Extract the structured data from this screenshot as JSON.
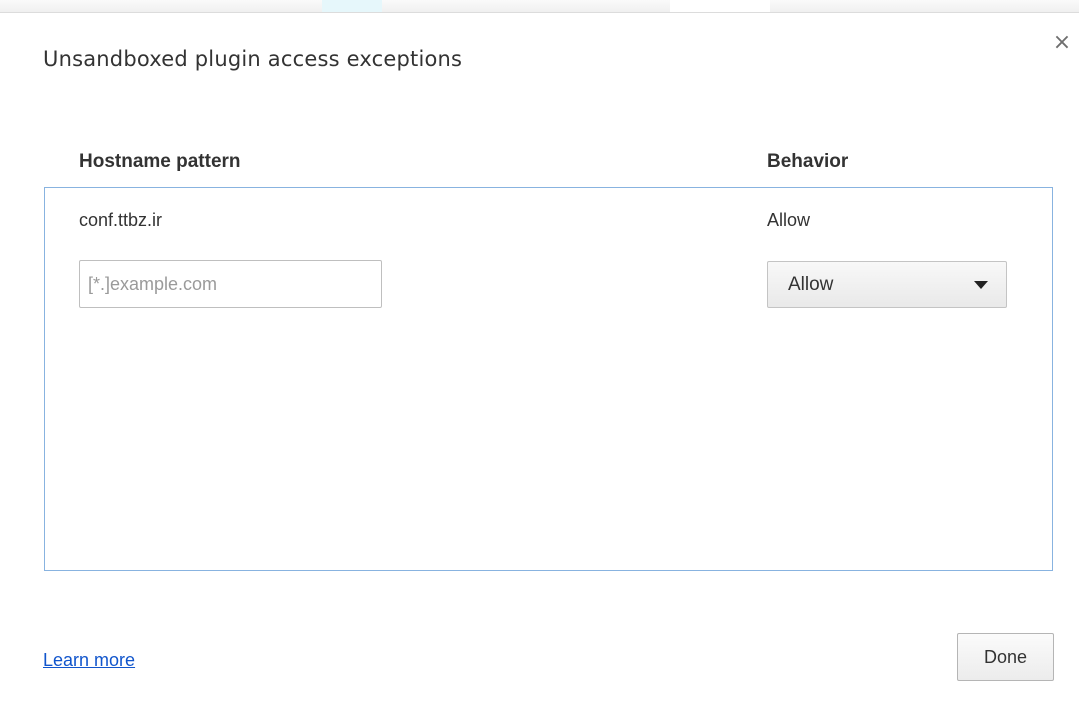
{
  "dialog": {
    "title": "Unsandboxed plugin access exceptions",
    "close_icon": "close-icon",
    "close_glyph": "×"
  },
  "table": {
    "columns": [
      "Hostname pattern",
      "Behavior"
    ],
    "rows": [
      {
        "hostname": "conf.ttbz.ir",
        "behavior": "Allow"
      }
    ],
    "new_entry": {
      "hostname_placeholder": "[*.]example.com",
      "hostname_value": "",
      "behavior_selected": "Allow",
      "behavior_icon": "chevron-down-icon"
    }
  },
  "footer": {
    "learn_more_label": "Learn more",
    "done_label": "Done"
  },
  "colors": {
    "link": "#1155cc",
    "list_border": "#88b3e0",
    "background_accent": "#e6f7fb"
  }
}
